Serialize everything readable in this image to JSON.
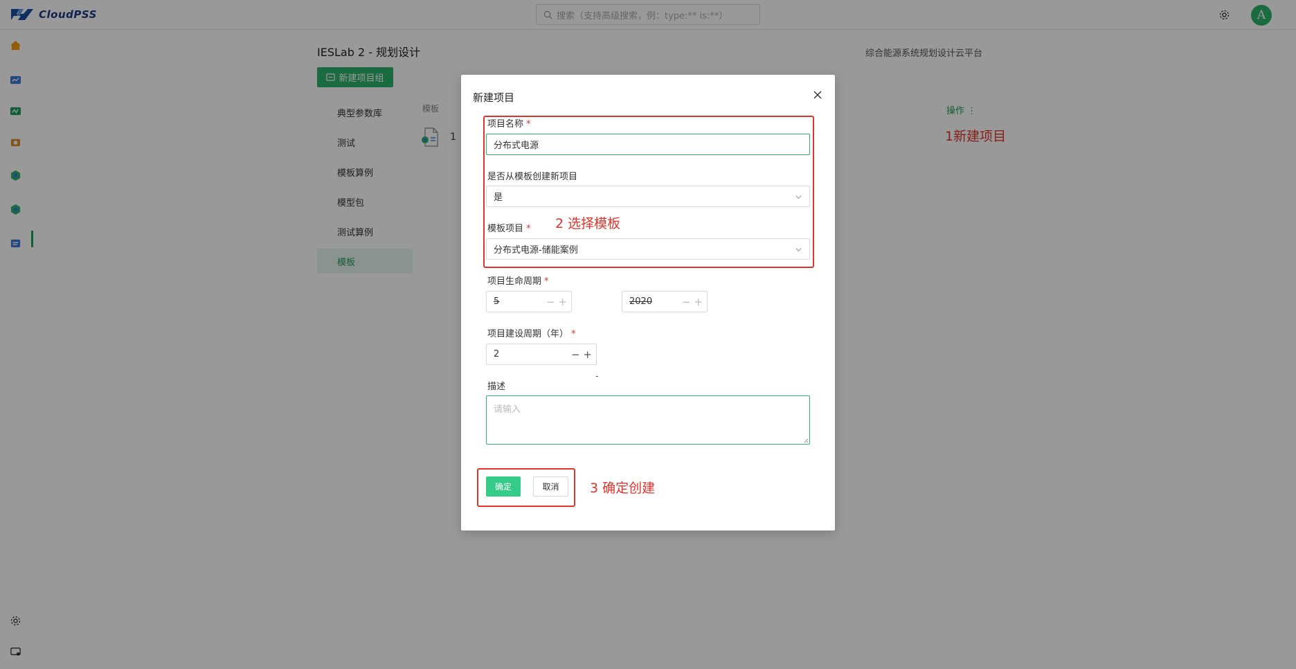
{
  "header": {
    "logo_text": "CloudPSS",
    "search_placeholder": "搜索（支持高级搜索，例：type:** is:**）",
    "avatar_letter": "A"
  },
  "page": {
    "title": "IESLab 2 - 规划设计",
    "platform_label": "综合能源系统规划设计云平台",
    "new_group_label": "新建项目组",
    "nav": [
      {
        "label": "典型参数库",
        "active": false
      },
      {
        "label": "测试",
        "active": false
      },
      {
        "label": "模板算例",
        "active": false
      },
      {
        "label": "模型包",
        "active": false
      },
      {
        "label": "测试算例",
        "active": false
      },
      {
        "label": "模板",
        "active": true
      }
    ],
    "col_header": "模板",
    "row_text": "1",
    "ops_label": "操作 ⋮",
    "annotation_1": "1新建项目"
  },
  "modal": {
    "title": "新建项目",
    "name_label": "项目名称",
    "name_value": "分布式电源",
    "from_template_label": "是否从模板创建新项目",
    "from_template_value": "是",
    "template_label": "模板项目",
    "template_value": "分布式电源-储能案例",
    "lifecycle_label": "项目生命周期",
    "lifecycle_years": "5",
    "lifecycle_start": "2020",
    "range_sep": "-",
    "build_label": "项目建设周期（年）",
    "build_value": "2",
    "desc_label": "描述",
    "desc_placeholder": "请输入",
    "confirm_label": "确定",
    "cancel_label": "取消",
    "required_mark": "*",
    "annotation_2": "2 选择模板",
    "annotation_3": "3 确定创建"
  },
  "colors": {
    "accent": "#2db36b",
    "annotation": "#e0342b"
  }
}
